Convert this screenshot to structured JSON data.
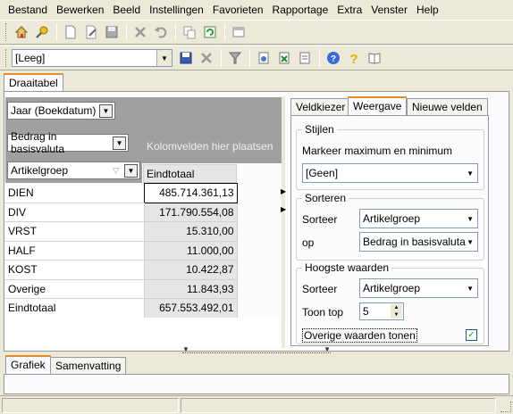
{
  "menu": [
    "Bestand",
    "Bewerken",
    "Beeld",
    "Instellingen",
    "Favorieten",
    "Rapportage",
    "Extra",
    "Venster",
    "Help"
  ],
  "toolbar1": {
    "icons": [
      "home-icon",
      "pin-icon",
      "new-document-icon",
      "edit-document-icon",
      "save-disk-icon",
      "delete-x-icon",
      "undo-icon",
      "copy-icon",
      "refresh-icon",
      "window-icon"
    ]
  },
  "toolbar2": {
    "layout_select": "[Leeg]",
    "icons": [
      "save-disk-icon",
      "delete-x-icon",
      "filter-icon",
      "export-icon",
      "excel-icon",
      "report-icon",
      "help-icon",
      "question-icon",
      "book-icon"
    ]
  },
  "main_tab": "Draaitabel",
  "pivot": {
    "filter_field": "Jaar (Boekdatum)",
    "data_field": "Bedrag in basisvaluta",
    "column_drop_hint": "Kolomvelden hier plaatsen",
    "row_field": "Artikelgroep",
    "total_header": "Eindtotaal",
    "rows": [
      {
        "label": "DIEN",
        "value": "485.714.361,13"
      },
      {
        "label": "DIV",
        "value": "171.790.554,08"
      },
      {
        "label": "VRST",
        "value": "15.310,00"
      },
      {
        "label": "HALF",
        "value": "11.000,00"
      },
      {
        "label": "KOST",
        "value": "10.422,87"
      },
      {
        "label": "Overige",
        "value": "11.843,93"
      },
      {
        "label": "Eindtotaal",
        "value": "657.553.492,01"
      }
    ]
  },
  "side_tabs": [
    "Veldkiezer",
    "Weergave",
    "Nieuwe velden"
  ],
  "styles": {
    "title": "Stijlen",
    "mark_label": "Markeer maximum en minimum",
    "mark_value": "[Geen]"
  },
  "sort": {
    "title": "Sorteren",
    "sort_label": "Sorteer",
    "sort_value": "Artikelgroep",
    "on_label": "op",
    "on_value": "Bedrag in basisvaluta"
  },
  "top": {
    "title": "Hoogste waarden",
    "sort_label": "Sorteer",
    "sort_value": "Artikelgroep",
    "show_label": "Toon top",
    "show_value": "5",
    "other_label": "Overige waarden tonen",
    "other_checked": true
  },
  "bottom_tabs": [
    "Grafiek",
    "Samenvatting"
  ]
}
